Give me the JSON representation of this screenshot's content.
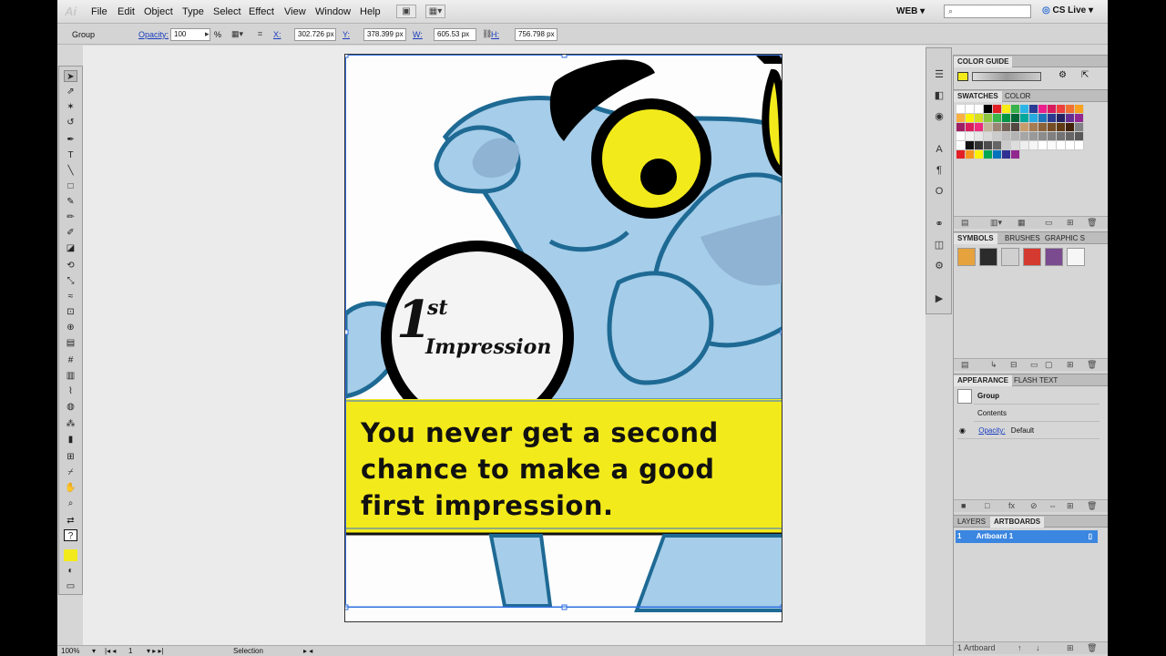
{
  "app": {
    "logo": "Ai"
  },
  "menu": [
    "File",
    "Edit",
    "Object",
    "Type",
    "Select",
    "Effect",
    "View",
    "Window",
    "Help"
  ],
  "menu_icons": [
    "bridge-icon",
    "arrange-documents-icon"
  ],
  "workspace": "WEB",
  "search": {
    "placeholder": ""
  },
  "cslive": "CS Live",
  "control": {
    "selection": "Group",
    "opacity_label": "Opacity:",
    "opacity_value": "100",
    "opacity_unit": "%",
    "x_label": "X:",
    "x_value": "302.726 px",
    "y_label": "Y:",
    "y_value": "378.399 px",
    "w_label": "W:",
    "w_value": "605.53 px",
    "h_label": "H:",
    "h_value": "756.798 px"
  },
  "artboard": {
    "logo_first": "1",
    "logo_sup": "st",
    "logo_word": "Impression",
    "quote_lines": [
      "You never get a second",
      "chance to make a good",
      "first impression."
    ]
  },
  "colors": {
    "banner_yellow": "#f3ea1b",
    "panther_blue": "#a6cde9",
    "panther_outline": "#1e6a94",
    "selection_blue": "#2f6fe0"
  },
  "status": {
    "zoom": "100%",
    "page": "1",
    "tool": "Selection"
  },
  "panels": {
    "color_guide_title": "COLOR GUIDE",
    "swatches_tab": "SWATCHES",
    "color_tab": "COLOR",
    "symbols_tab": "SYMBOLS",
    "brushes_tab": "BRUSHES",
    "graphic_tab": "GRAPHIC S",
    "appearance_tab": "APPEARANCE",
    "flash_text_tab": "FLASH TEXT",
    "appearance_group": "Group",
    "appearance_contents": "Contents",
    "appearance_opacity_label": "Opacity:",
    "appearance_opacity_value": "Default",
    "layers_tab": "LAYERS",
    "artboards_tab": "ARTBOARDS",
    "artboard_number": "1",
    "artboard_name": "Artboard 1",
    "artboards_count": "1 Artboard"
  }
}
